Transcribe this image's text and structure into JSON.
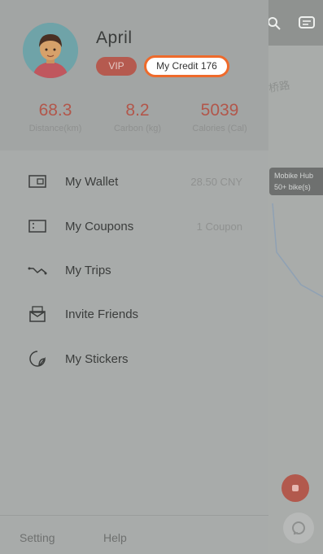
{
  "profile": {
    "name": "April",
    "vip_label": "VIP",
    "credit_label": "My Credit 176"
  },
  "stats": [
    {
      "value": "68.3",
      "label": "Distance(km)"
    },
    {
      "value": "8.2",
      "label": "Carbon (kg)"
    },
    {
      "value": "5039",
      "label": "Calories (Cal)"
    }
  ],
  "menu": [
    {
      "label": "My Wallet",
      "value": "28.50 CNY",
      "icon": "wallet-icon"
    },
    {
      "label": "My Coupons",
      "value": "1 Coupon",
      "icon": "coupon-icon"
    },
    {
      "label": "My Trips",
      "value": "",
      "icon": "trips-icon"
    },
    {
      "label": "Invite Friends",
      "value": "",
      "icon": "invite-icon"
    },
    {
      "label": "My Stickers",
      "value": "",
      "icon": "sticker-icon"
    }
  ],
  "footer": {
    "setting_label": "Setting",
    "help_label": "Help"
  },
  "map": {
    "road_text": "桥路",
    "bubble_line1": "Mobike Hub",
    "bubble_line2": "50+ bike(s)"
  }
}
